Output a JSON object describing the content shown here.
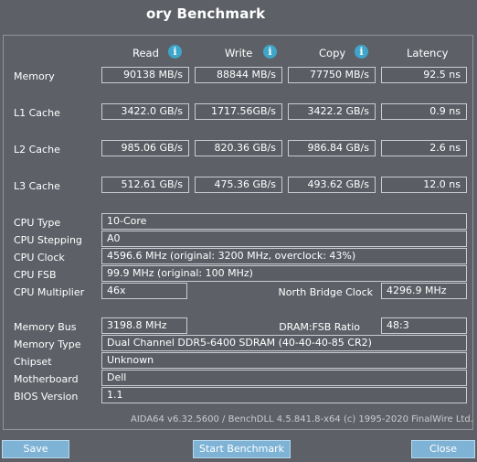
{
  "title": "ory Benchmark",
  "columns": {
    "read": "Read",
    "write": "Write",
    "copy": "Copy",
    "latency": "Latency"
  },
  "rows": {
    "memory": {
      "label": "Memory",
      "read": "90138 MB/s",
      "write": "88844 MB/s",
      "copy": "77750 MB/s",
      "latency": "92.5 ns"
    },
    "l1": {
      "label": "L1 Cache",
      "read": "3422.0 GB/s",
      "write": "1717.56GB/s",
      "copy": "3422.2 GB/s",
      "latency": "0.9 ns"
    },
    "l2": {
      "label": "L2 Cache",
      "read": "985.06 GB/s",
      "write": "820.36 GB/s",
      "copy": "986.84 GB/s",
      "latency": "2.6 ns"
    },
    "l3": {
      "label": "L3 Cache",
      "read": "512.61 GB/s",
      "write": "475.36 GB/s",
      "copy": "493.62 GB/s",
      "latency": "12.0 ns"
    }
  },
  "cpu": {
    "type_label": "CPU Type",
    "type": "10-Core",
    "stepping_label": "CPU Stepping",
    "stepping": "A0",
    "clock_label": "CPU Clock",
    "clock": "4596.6 MHz  (original: 3200 MHz, overclock: 43%)",
    "fsb_label": "CPU FSB",
    "fsb": "99.9 MHz  (original: 100 MHz)",
    "multiplier_label": "CPU Multiplier",
    "multiplier": "46x",
    "nb_clock_label": "North Bridge Clock",
    "nb_clock": "4296.9 MHz"
  },
  "system": {
    "membus_label": "Memory Bus",
    "membus": "3198.8 MHz",
    "dram_ratio_label": "DRAM:FSB Ratio",
    "dram_ratio": "48:3",
    "memtype_label": "Memory Type",
    "memtype": "Dual Channel DDR5-6400 SDRAM  (40-40-40-85 CR2)",
    "chipset_label": "Chipset",
    "chipset": "Unknown",
    "motherboard_label": "Motherboard",
    "motherboard": "Dell",
    "bios_label": "BIOS Version",
    "bios": "1.1"
  },
  "footer": "AIDA64 v6.32.5600 / BenchDLL 4.5.841.8-x64  (c) 1995-2020 FinalWire Ltd.",
  "buttons": {
    "save": "Save",
    "start": "Start Benchmark",
    "close": "Close"
  }
}
